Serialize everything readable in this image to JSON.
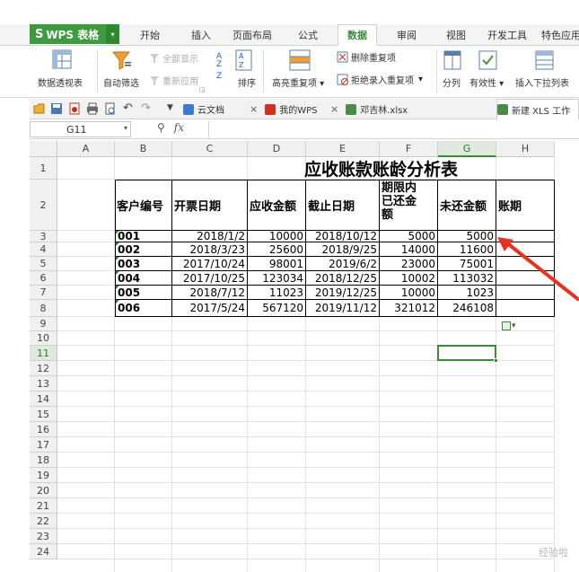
{
  "app": {
    "name": "WPS 表格",
    "logo": "S"
  },
  "menu": {
    "tabs": [
      "开始",
      "插入",
      "页面布局",
      "公式",
      "数据",
      "审阅",
      "视图",
      "开发工具",
      "特色应用"
    ],
    "active_tab": "数据"
  },
  "ribbon": {
    "pivot": "数据透视表",
    "autofilter": "自动筛选",
    "show_all": "全部显示",
    "reapply": "重新应用",
    "sort": "排序",
    "highlight_dup": "高亮重复项",
    "delete_dup": "删除重复项",
    "reject_dup": "拒绝录入重复项",
    "split": "分列",
    "validity": "有效性",
    "dropdown_list": "插入下拉列表"
  },
  "doc_tabs": [
    {
      "label": "云文档",
      "icon": "cloud-icon"
    },
    {
      "label": "我的WPS",
      "icon": "wps-icon"
    },
    {
      "label": "邓吉林.xlsx",
      "icon": "sheet-icon"
    },
    {
      "label": "新建 XLS 工作",
      "icon": "sheet-icon"
    }
  ],
  "formula_bar": {
    "name_box": "G11",
    "fx": "fx",
    "formula": ""
  },
  "columns": [
    "A",
    "B",
    "C",
    "D",
    "E",
    "F",
    "G",
    "H"
  ],
  "rows": [
    "1",
    "2",
    "3",
    "4",
    "5",
    "6",
    "7",
    "8",
    "9",
    "10",
    "11",
    "12",
    "13",
    "14",
    "15",
    "16",
    "17",
    "18",
    "19",
    "20",
    "21",
    "22",
    "23",
    "24"
  ],
  "selected_cell": {
    "column": "G",
    "row": "11"
  },
  "sheet": {
    "title": "应收账款账龄分析表",
    "headers": [
      "客户编号",
      "开票日期",
      "应收金额",
      "截止日期",
      "期限内\n已还金\n额",
      "未还金额",
      "账期"
    ],
    "records": [
      [
        "001",
        "2018/1/2",
        "10000",
        "2018/10/12",
        "5000",
        "5000",
        ""
      ],
      [
        "002",
        "2018/3/23",
        "25600",
        "2018/9/25",
        "14000",
        "11600",
        ""
      ],
      [
        "003",
        "2017/10/24",
        "98001",
        "2019/6/2",
        "23000",
        "75001",
        ""
      ],
      [
        "004",
        "2017/10/25",
        "123034",
        "2018/12/25",
        "10002",
        "113032",
        ""
      ],
      [
        "005",
        "2018/7/12",
        "11023",
        "2019/12/25",
        "10000",
        "1023",
        ""
      ],
      [
        "006",
        "2017/5/24",
        "567120",
        "2019/11/12",
        "321012",
        "246108",
        ""
      ]
    ]
  },
  "colors": {
    "accent": "#3a8a3a",
    "arrow": "#e8321e"
  },
  "watermark": "经验啦"
}
